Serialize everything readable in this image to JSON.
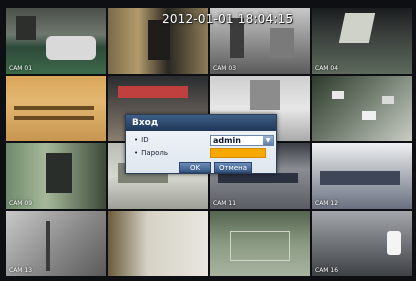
{
  "overlay": {
    "timestamp": "2012-01-01 18:04:15"
  },
  "cameras": [
    {
      "label": "CAM 01"
    },
    {
      "label": ""
    },
    {
      "label": "CAM 03"
    },
    {
      "label": "CAM 04"
    },
    {
      "label": ""
    },
    {
      "label": ""
    },
    {
      "label": ""
    },
    {
      "label": ""
    },
    {
      "label": "CAM 09"
    },
    {
      "label": ""
    },
    {
      "label": "CAM 11"
    },
    {
      "label": "CAM 12"
    },
    {
      "label": "CAM 13"
    },
    {
      "label": ""
    },
    {
      "label": ""
    },
    {
      "label": "CAM 16"
    }
  ],
  "login": {
    "title": "Вход",
    "id_label": "ID",
    "id_value": "admin",
    "password_label": "Пароль",
    "ok_label": "OK",
    "cancel_label": "Отмена"
  }
}
